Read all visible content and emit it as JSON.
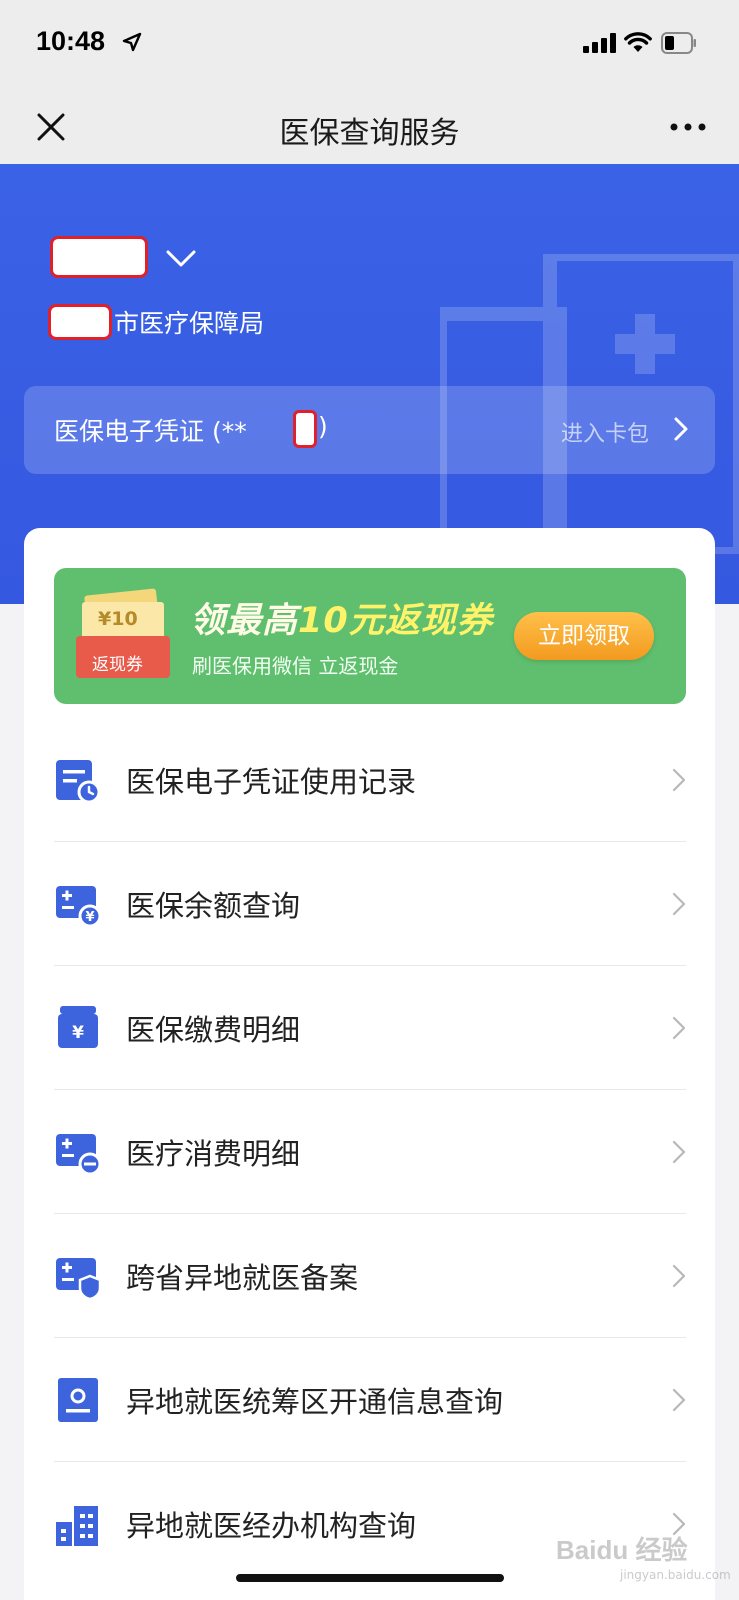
{
  "status_bar": {
    "time": "10:48"
  },
  "nav": {
    "title": "医保查询服务"
  },
  "header": {
    "bureau_suffix": "市医疗保障局",
    "credential_label": "医保电子凭证 (**",
    "credential_close": ")",
    "enter_wallet": "进入卡包"
  },
  "promo": {
    "coupon_amount": "¥10",
    "coupon_tag": "返现券",
    "title_prefix": "领最高",
    "title_highlight": "10元返现券",
    "subtitle": "刷医保用微信 立返现金",
    "button": "立即领取"
  },
  "menu": {
    "items": [
      {
        "label": "医保电子凭证使用记录",
        "icon": "record-clock-icon"
      },
      {
        "label": "医保余额查询",
        "icon": "balance-yen-icon"
      },
      {
        "label": "医保缴费明细",
        "icon": "payment-yen-icon"
      },
      {
        "label": "医疗消费明细",
        "icon": "consumption-minus-icon"
      },
      {
        "label": "跨省异地就医备案",
        "icon": "shield-card-icon"
      },
      {
        "label": "异地就医统筹区开通信息查询",
        "icon": "id-badge-icon"
      },
      {
        "label": "异地就医经办机构查询",
        "icon": "building-icon"
      }
    ]
  },
  "watermark": {
    "brand": "Baidu 经验",
    "url": "jingyan.baidu.com"
  },
  "colors": {
    "primary_blue": "#3a62e6",
    "icon_blue": "#3d63dd",
    "promo_green": "#5fbf6e",
    "button_orange": "#f39a1f"
  }
}
